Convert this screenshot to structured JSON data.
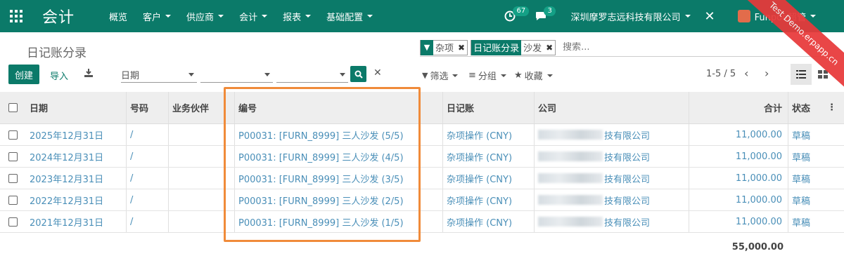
{
  "nav": {
    "app_name": "会计",
    "menu": [
      {
        "label": "概览",
        "dropdown": false
      },
      {
        "label": "客户",
        "dropdown": true
      },
      {
        "label": "供应商",
        "dropdown": true
      },
      {
        "label": "会计",
        "dropdown": true
      },
      {
        "label": "报表",
        "dropdown": true
      },
      {
        "label": "基础配置",
        "dropdown": true
      }
    ],
    "activity_count": "67",
    "message_count": "3",
    "company": "深圳摩罗志远科技有限公司",
    "user": "Funpoo超管"
  },
  "ribbon": "Test Demo.erpapp.cn",
  "breadcrumb": "日记账分录",
  "search": {
    "facets": [
      {
        "icon": "filter-icon",
        "label": "",
        "values": "杂项"
      },
      {
        "icon": "",
        "label": "日记账分录",
        "values": "沙发"
      }
    ],
    "placeholder": "搜索..."
  },
  "toolbar": {
    "create": "创建",
    "import": "导入",
    "date_select": "日期",
    "filter": "筛选",
    "group": "分组",
    "favorites": "收藏",
    "pager": "1-5 / 5"
  },
  "table": {
    "headers": {
      "date": "日期",
      "number": "号码",
      "partner": "业务伙伴",
      "ref": "编号",
      "journal": "日记账",
      "company": "公司",
      "total": "合计",
      "state": "状态"
    },
    "rows": [
      {
        "date": "2025年12月31日",
        "number": "/",
        "partner": "",
        "ref": "P00031: [FURN_8999] 三人沙发 (5/5)",
        "journal": "杂项操作 (CNY)",
        "company": "技有限公司",
        "total": "11,000.00",
        "state": "草稿"
      },
      {
        "date": "2024年12月31日",
        "number": "/",
        "partner": "",
        "ref": "P00031: [FURN_8999] 三人沙发 (4/5)",
        "journal": "杂项操作 (CNY)",
        "company": "技有限公司",
        "total": "11,000.00",
        "state": "草稿"
      },
      {
        "date": "2023年12月31日",
        "number": "/",
        "partner": "",
        "ref": "P00031: [FURN_8999] 三人沙发 (3/5)",
        "journal": "杂项操作 (CNY)",
        "company": "技有限公司",
        "total": "11,000.00",
        "state": "草稿"
      },
      {
        "date": "2022年12月31日",
        "number": "/",
        "partner": "",
        "ref": "P00031: [FURN_8999] 三人沙发 (2/5)",
        "journal": "杂项操作 (CNY)",
        "company": "技有限公司",
        "total": "11,000.00",
        "state": "草稿"
      },
      {
        "date": "2021年12月31日",
        "number": "/",
        "partner": "",
        "ref": "P00031: [FURN_8999] 三人沙发 (1/5)",
        "journal": "杂项操作 (CNY)",
        "company": "技有限公司",
        "total": "11,000.00",
        "state": "草稿"
      }
    ],
    "grand_total": "55,000.00"
  },
  "colors": {
    "primary": "#0b7a69",
    "link": "#4a8fb8",
    "highlight": "#f08b3a",
    "ribbon": "#e8393a"
  }
}
